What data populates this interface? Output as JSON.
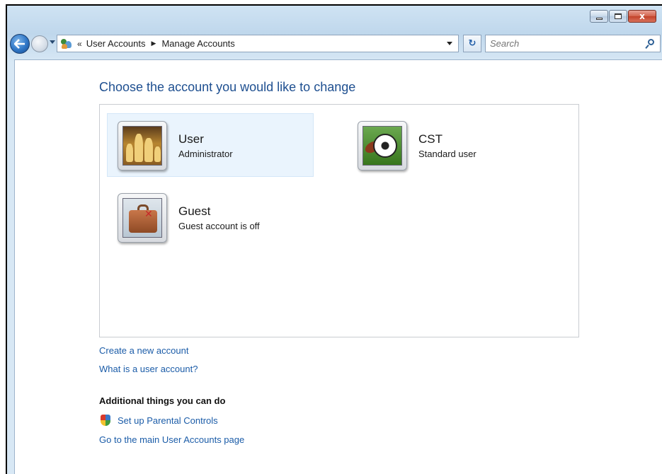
{
  "window": {
    "caption_close": "x"
  },
  "navigation": {
    "breadcrumb_overflow": "«",
    "breadcrumb_separator": "▶",
    "breadcrumb": [
      "User Accounts",
      "Manage Accounts"
    ],
    "refresh_glyph": "↻"
  },
  "search": {
    "placeholder": "Search"
  },
  "main": {
    "title": "Choose the account you would like to change",
    "accounts": [
      {
        "name": "User",
        "type": "Administrator",
        "picture": "chess-icon",
        "selected": true
      },
      {
        "name": "CST",
        "type": "Standard user",
        "picture": "soccer-ball-icon",
        "selected": false
      },
      {
        "name": "Guest",
        "type": "Guest account is off",
        "picture": "suitcase-icon",
        "selected": false
      }
    ],
    "links": {
      "create_account": "Create a new account",
      "what_is_account": "What is a user account?"
    },
    "additional": {
      "heading": "Additional things you can do",
      "parental_controls": "Set up Parental Controls",
      "main_page": "Go to the main User Accounts page"
    }
  },
  "colors": {
    "link": "#1b5ca8",
    "title": "#1e4f90",
    "selected_account_bg": "#eaf4fd"
  }
}
